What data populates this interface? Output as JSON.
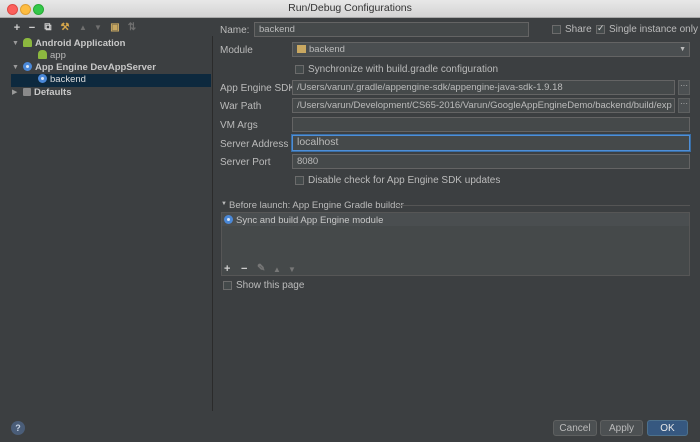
{
  "window": {
    "title": "Run/Debug Configurations"
  },
  "toolbar": {
    "add": "+",
    "remove": "−",
    "copy": "⧉",
    "edit": "⚒",
    "up": "▲",
    "down": "▼",
    "folder": "▣",
    "sort": "⇅"
  },
  "tree": {
    "android_app": "Android Application",
    "app": "app",
    "gae_devapp": "App Engine DevAppServer",
    "backend": "backend",
    "defaults": "Defaults"
  },
  "form": {
    "name_label": "Name:",
    "name_value": "backend",
    "share_label": "Share",
    "single_instance_label": "Single instance only",
    "module_label": "Module",
    "module_value": "backend",
    "sync_label": "Synchronize with build.gradle configuration",
    "sdk_label": "App Engine SDK",
    "sdk_value": "/Users/varun/.gradle/appengine-sdk/appengine-java-sdk-1.9.18",
    "war_label": "War Path",
    "war_value": "/Users/varun/Development/CS65-2016/Varun/GoogleAppEngineDemo/backend/build/exp",
    "vm_label": "VM Args",
    "vm_value": "",
    "server_address_label": "Server Address",
    "server_address_value": "localhost",
    "server_port_label": "Server Port",
    "server_port_value": "8080",
    "disable_check_label": "Disable check for App Engine SDK updates",
    "browse": "···"
  },
  "before_launch": {
    "header": "Before launch: App Engine Gradle builder",
    "item": "Sync and build App Engine module",
    "tools": {
      "add": "+",
      "remove": "−",
      "edit": "✎",
      "up": "▲",
      "down": "▼"
    },
    "show_page_label": "Show this page"
  },
  "buttons": {
    "cancel": "Cancel",
    "apply": "Apply",
    "ok": "OK",
    "help": "?"
  },
  "state": {
    "share": false,
    "single_instance": true,
    "sync": false,
    "disable_check": false,
    "show_page": false
  },
  "colors": {
    "background": "#3c3f41",
    "selection": "#0d293e",
    "accent": "#365880",
    "focus": "#4e8fd8"
  }
}
